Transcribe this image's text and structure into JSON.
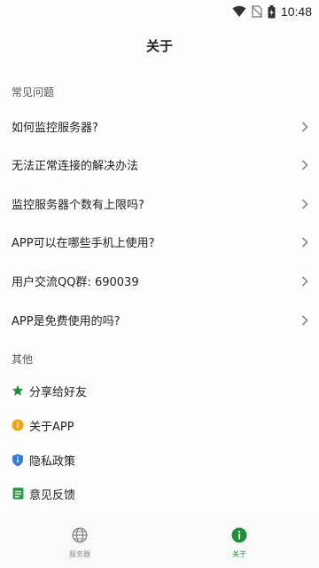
{
  "status_bar": {
    "time": "10:48"
  },
  "header": {
    "title": "关于"
  },
  "faq": {
    "heading": "常见问题",
    "items": [
      {
        "label": "如何监控服务器?"
      },
      {
        "label": "无法正常连接的解决办法"
      },
      {
        "label": "监控服务器个数有上限吗?"
      },
      {
        "label": "APP可以在哪些手机上使用?"
      },
      {
        "label": "用户交流QQ群: 690039"
      },
      {
        "label": "APP是免费使用的吗?"
      }
    ]
  },
  "other": {
    "heading": "其他",
    "items": [
      {
        "label": "分享给好友",
        "icon": "star-icon",
        "color": "#1e8f3a"
      },
      {
        "label": "关于APP",
        "icon": "info-icon",
        "color": "#f2a20c"
      },
      {
        "label": "隐私政策",
        "icon": "shield-icon",
        "color": "#2f7fd6"
      },
      {
        "label": "意见反馈",
        "icon": "feedback-icon",
        "color": "#2e9a4a"
      }
    ]
  },
  "bottom_nav": {
    "items": [
      {
        "label": "服务器",
        "icon": "globe-icon",
        "active": false
      },
      {
        "label": "关于",
        "icon": "info-icon",
        "active": true
      }
    ]
  },
  "colors": {
    "accent": "#1e8f3a",
    "inactive": "#888888"
  }
}
